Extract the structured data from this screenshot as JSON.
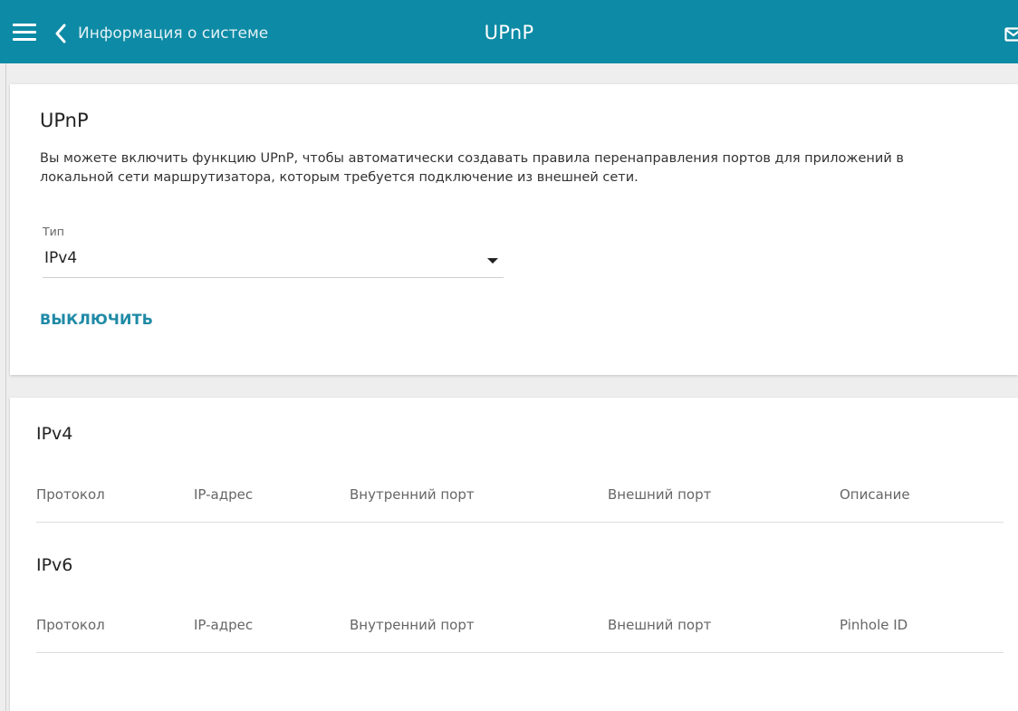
{
  "header": {
    "back_label": "Информация о системе",
    "title": "UPnP",
    "icons": {
      "menu": "menu-icon",
      "back": "chevron-left-icon",
      "mail": "mail-icon"
    },
    "color": "#0d8aa5"
  },
  "upnp_card": {
    "title": "UPnP",
    "description": "Вы можете включить функцию UPnP, чтобы автоматически создавать правила перенаправления портов для приложений в локальной сети маршрутизатора, которым требуется подключение из внешней сети.",
    "type_label": "Тип",
    "type_value": "IPv4",
    "disable_button": "ВЫКЛЮЧИТЬ",
    "accent": "#1f8aa6"
  },
  "tables": {
    "ipv4": {
      "title": "IPv4",
      "columns": [
        "Протокол",
        "IP-адрес",
        "Внутренний порт",
        "Внешний порт",
        "Описание"
      ],
      "rows": []
    },
    "ipv6": {
      "title": "IPv6",
      "columns": [
        "Протокол",
        "IP-адрес",
        "Внутренний порт",
        "Внешний порт",
        "Pinhole ID"
      ],
      "rows": []
    }
  }
}
